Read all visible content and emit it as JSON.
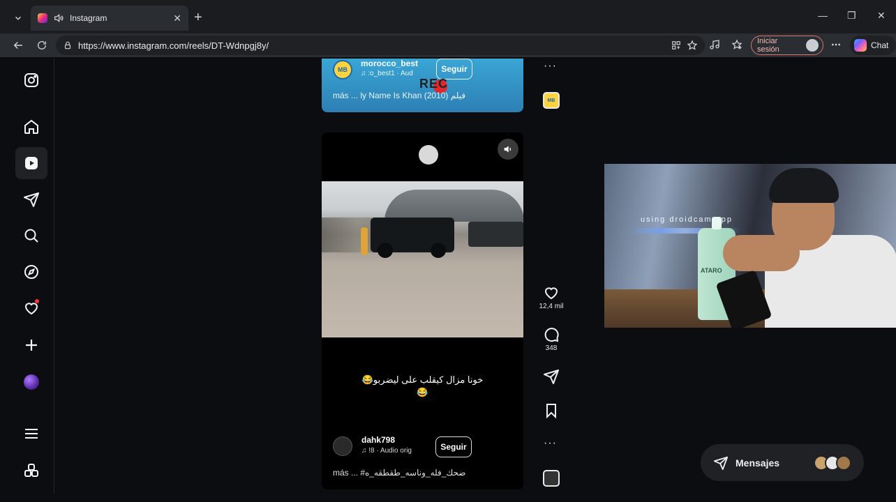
{
  "browser": {
    "tab_title": "Instagram",
    "tab_close": "✕",
    "new_tab": "+",
    "url": "https://www.instagram.com/reels/DT-Wdnpgj8y/",
    "signin_label": "Iniciar sesión",
    "chat_label": "Chat",
    "win_minimize": "—",
    "win_restore": "❐",
    "win_close": "✕"
  },
  "sidebar": {
    "items": [
      {
        "name": "instagram-logo"
      },
      {
        "name": "home"
      },
      {
        "name": "reels",
        "active": true
      },
      {
        "name": "messages"
      },
      {
        "name": "search"
      },
      {
        "name": "explore"
      },
      {
        "name": "notifications"
      },
      {
        "name": "create"
      },
      {
        "name": "profile"
      },
      {
        "name": "more"
      },
      {
        "name": "also-from-meta"
      }
    ]
  },
  "prev_reel": {
    "avatar_text": "MB",
    "username": "morocco_best",
    "audio": "♫ :o_best1 · Aud",
    "follow_label": "Seguir",
    "rec_text": "REC",
    "caption": "más ... ly Name Is Khan (2010) فيلم"
  },
  "reel": {
    "caption_line1": "خونا مزال كيقلب على ليضربو😂",
    "caption_line2": "😂",
    "username": "dahk798",
    "audio": "♫ !8 · Audio orig",
    "follow_label": "Seguir",
    "description": "más ... #ضحك_فله_وناسه_طقطقه_ه"
  },
  "actions": {
    "likes": "12,4 mil",
    "comments": "348",
    "more": "···"
  },
  "cam": {
    "watermark": "using droidcam.app",
    "bottle_label": "ATARO"
  },
  "messages": {
    "label": "Mensajes"
  }
}
